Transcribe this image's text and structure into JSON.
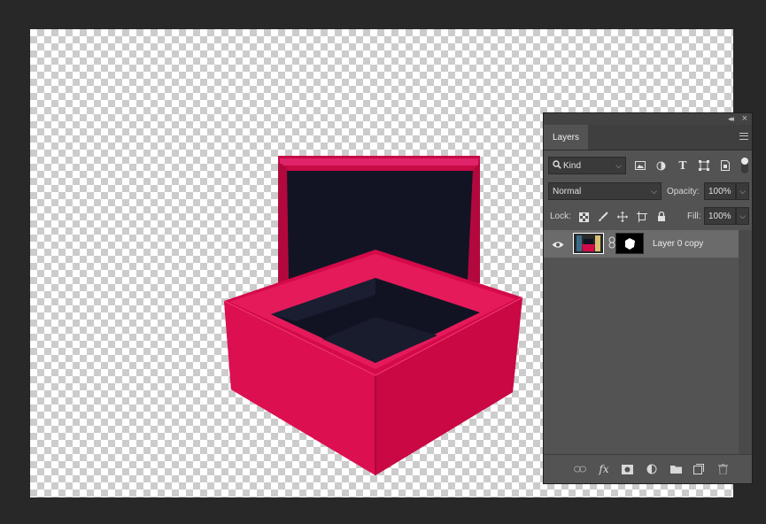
{
  "panel": {
    "title": "Layers",
    "filter_label": "Kind",
    "blend_mode": "Normal",
    "opacity_label": "Opacity:",
    "opacity_value": "100%",
    "lock_label": "Lock:",
    "fill_label": "Fill:",
    "fill_value": "100%"
  },
  "layers": [
    {
      "name": "Layer 0 copy",
      "visible": true,
      "selected": true
    }
  ],
  "icons": {
    "filter": "search-icon",
    "filter_types": [
      "image-filter-icon",
      "adjustment-filter-icon",
      "type-filter-icon",
      "shape-filter-icon",
      "smart-object-filter-icon"
    ],
    "locks": [
      "lock-transparent-pixels-icon",
      "lock-image-pixels-icon",
      "lock-position-icon",
      "lock-artboard-icon",
      "lock-all-icon"
    ],
    "bottom": [
      "link-layers-icon",
      "fx-icon",
      "add-mask-icon",
      "adjustment-layer-icon",
      "new-group-icon",
      "new-layer-icon",
      "trash-icon"
    ]
  },
  "colors": {
    "workspace": "#282828",
    "panel": "#535353",
    "selected_layer": "#6b6b6b",
    "box_pink": "#d40a49",
    "box_interior": "#111322"
  }
}
